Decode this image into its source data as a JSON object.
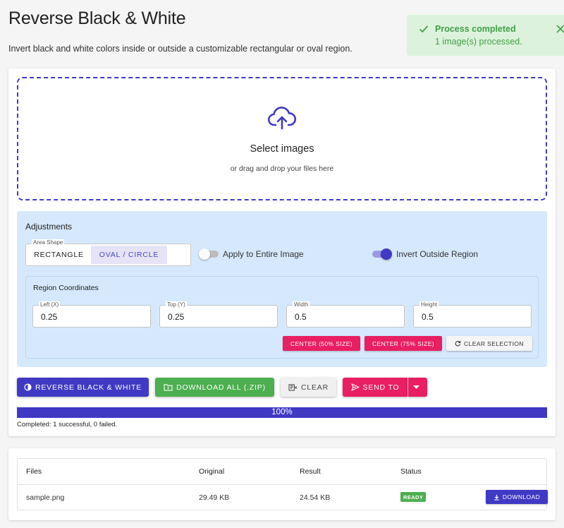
{
  "header": {
    "title": "Reverse Black & White",
    "description": "Invert black and white colors inside or outside a customizable rectangular or oval region."
  },
  "toast": {
    "title": "Process completed",
    "message": "1 image(s) processed.",
    "icon": "check-icon",
    "close_icon": "close-icon"
  },
  "dropzone": {
    "icon": "cloud-upload-icon",
    "title": "Select images",
    "subtitle": "or drag and drop your files here"
  },
  "adjustments": {
    "title": "Adjustments",
    "area_shape": {
      "label": "Area Shape",
      "options": [
        "RECTANGLE",
        "OVAL / CIRCLE"
      ],
      "selected": "OVAL / CIRCLE"
    },
    "apply_entire": {
      "label": "Apply to Entire Image",
      "on": false
    },
    "invert_outside": {
      "label": "Invert Outside Region",
      "on": true
    },
    "region": {
      "title": "Region Coordinates",
      "fields": [
        {
          "label": "Left (X)",
          "value": "0.25"
        },
        {
          "label": "Top (Y)",
          "value": "0.25"
        },
        {
          "label": "Width",
          "value": "0.5"
        },
        {
          "label": "Height",
          "value": "0.5"
        }
      ],
      "center50_label": "CENTER (50% SIZE)",
      "center75_label": "CENTER (75% SIZE)",
      "clear_selection_label": "CLEAR SELECTION"
    }
  },
  "actions": {
    "reverse_label": "REVERSE BLACK & WHITE",
    "download_zip_label": "DOWNLOAD ALL (.ZIP)",
    "clear_label": "CLEAR",
    "send_to_label": "SEND TO"
  },
  "progress": {
    "value": 1.0,
    "label": "100%",
    "status": "Completed: 1 successful, 0 failed."
  },
  "files_table": {
    "headers": [
      "Files",
      "Original",
      "Result",
      "Status"
    ],
    "rows": [
      {
        "file": "sample.png",
        "original": "29.49 KB",
        "result": "24.54 KB",
        "status": "READY",
        "action": "DOWNLOAD"
      }
    ]
  },
  "colors": {
    "primary": "#3f39c4",
    "accent": "#e91e63",
    "success": "#4caf50",
    "adjust_bg": "#d6e9fc",
    "toast_bg": "#dcf2dc"
  }
}
